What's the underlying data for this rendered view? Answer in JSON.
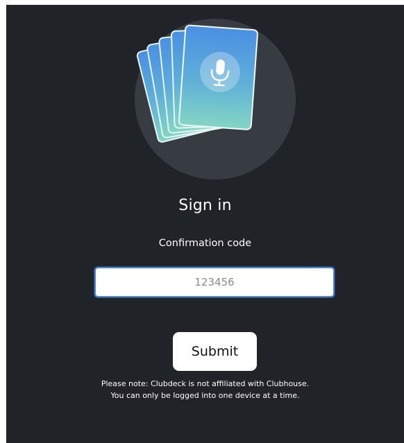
{
  "app": {
    "logo_icon": "microphone-cards-icon"
  },
  "signin": {
    "title": "Sign in",
    "field_label": "Confirmation code",
    "code_placeholder": "123456",
    "code_value": "",
    "submit_label": "Submit"
  },
  "note": {
    "line1": "Please note: Clubdeck is not affiliated with Clubhouse.",
    "line2": "You can only be logged into one device at a time."
  },
  "colors": {
    "background": "#202428",
    "circle": "#373c43",
    "card_gradient_top": "#4a90e2",
    "card_gradient_bottom": "#7fd3c4",
    "input_focus_border": "#4a84d6"
  }
}
